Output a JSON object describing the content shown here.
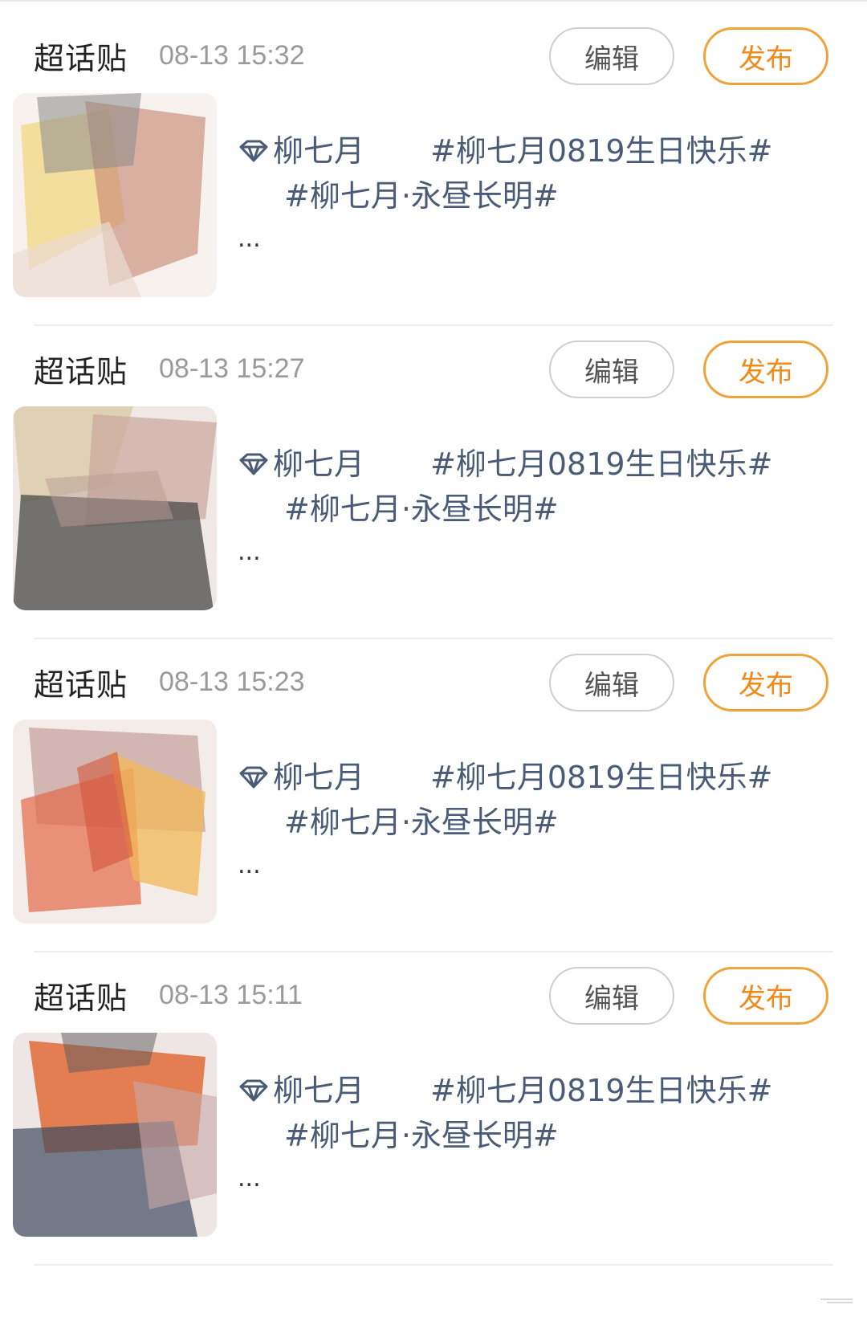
{
  "drafts": [
    {
      "type": "超话贴",
      "time": "08-13 15:32",
      "edit_label": "编辑",
      "publish_label": "发布",
      "topic": "柳七月",
      "tag1": "#柳七月0819生日快乐#",
      "tag2": "#柳七月·永昼长明#",
      "more": "...",
      "thumbnail_colors": [
        "#f1d88a",
        "#c98a78",
        "#8a8a8a"
      ]
    },
    {
      "type": "超话贴",
      "time": "08-13 15:27",
      "edit_label": "编辑",
      "publish_label": "发布",
      "topic": "柳七月",
      "tag1": "#柳七月0819生日快乐#",
      "tag2": "#柳七月·永昼长明#",
      "more": "...",
      "thumbnail_colors": [
        "#d8c79e",
        "#c9a79d",
        "#4a4a4a"
      ]
    },
    {
      "type": "超话贴",
      "time": "08-13 15:23",
      "edit_label": "编辑",
      "publish_label": "发布",
      "topic": "柳七月",
      "tag1": "#柳七月0819生日快乐#",
      "tag2": "#柳七月·永昼长明#",
      "more": "...",
      "thumbnail_colors": [
        "#e46a4a",
        "#f2b85a",
        "#b48a84"
      ]
    },
    {
      "type": "超话贴",
      "time": "08-13 15:11",
      "edit_label": "编辑",
      "publish_label": "发布",
      "topic": "柳七月",
      "tag1": "#柳七月0819生日快乐#",
      "tag2": "#柳七月·永昼长明#",
      "more": "...",
      "thumbnail_colors": [
        "#e0642e",
        "#3e4a5e",
        "#c8a8a8"
      ]
    }
  ],
  "icons": {
    "topic": "diamond-icon",
    "moon": "crescent-moon-icon"
  },
  "colors": {
    "accent": "#f08a1c",
    "link": "#4a5b77",
    "muted": "#9a9a9a"
  }
}
